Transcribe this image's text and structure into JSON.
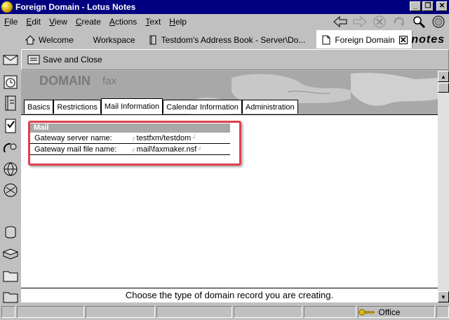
{
  "window": {
    "title": "Foreign Domain - Lotus Notes"
  },
  "menubar": {
    "items": [
      {
        "label": "File",
        "key": "F",
        "rest": "ile"
      },
      {
        "label": "Edit",
        "key": "E",
        "rest": "dit"
      },
      {
        "label": "View",
        "key": "V",
        "rest": "iew"
      },
      {
        "label": "Create",
        "key": "C",
        "rest": "reate"
      },
      {
        "label": "Actions",
        "key": "A",
        "rest": "ctions"
      },
      {
        "label": "Text",
        "key": "T",
        "rest": "ext"
      },
      {
        "label": "Help",
        "key": "H",
        "rest": "elp"
      }
    ]
  },
  "window_tabs": [
    {
      "label": "Welcome",
      "icon": "home-icon"
    },
    {
      "label": "Workspace",
      "icon": "workspace-icon"
    },
    {
      "label": "Testdom's Address Book - Server\\Do...",
      "icon": "address-book-icon"
    },
    {
      "label": "Foreign Domain",
      "icon": "document-icon",
      "active": true
    }
  ],
  "logo": "notes",
  "actionbar": {
    "save_close_label": "Save and Close"
  },
  "banner": {
    "title": "DOMAIN",
    "subtitle": "fax"
  },
  "form_tabs": [
    {
      "label": "Basics"
    },
    {
      "label": "Restrictions"
    },
    {
      "label": "Mail Information",
      "active": true
    },
    {
      "label": "Calendar Information"
    },
    {
      "label": "Administration"
    }
  ],
  "mail_section": {
    "heading": "Mail",
    "fields": [
      {
        "label": "Gateway server name:",
        "value": "testfxm/testdom"
      },
      {
        "label": "Gateway mail file name:",
        "value": "mail\\faxmaker.nsf"
      }
    ]
  },
  "hint": "Choose the type of domain record you are creating.",
  "statusbar": {
    "location": "Office"
  },
  "colors": {
    "titlebar": "#000080",
    "highlight_border": "#e04050",
    "banner": "#a8a8a8"
  }
}
